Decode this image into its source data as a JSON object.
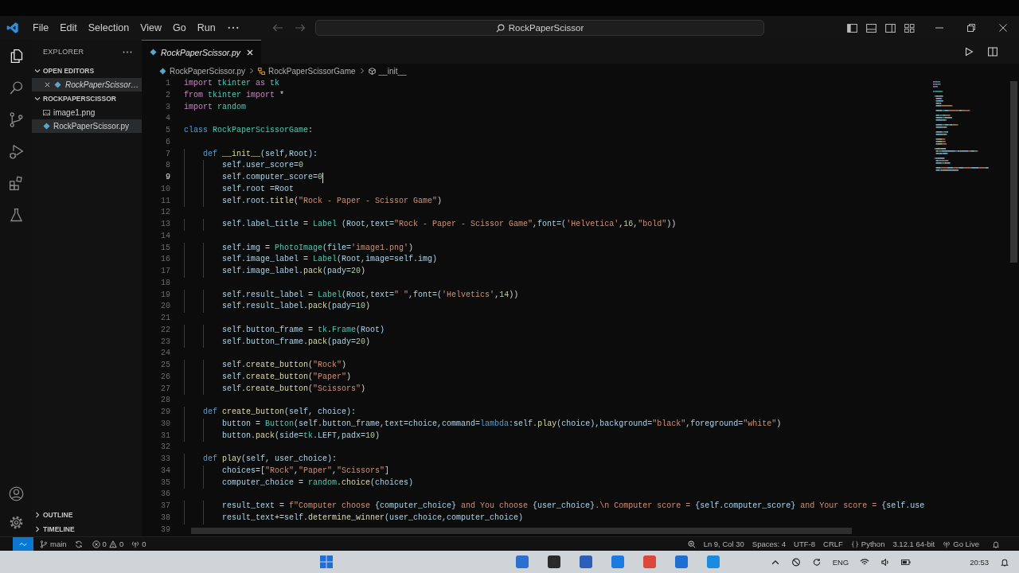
{
  "title_bar": {
    "menu": [
      "File",
      "Edit",
      "Selection",
      "View",
      "Go",
      "Run"
    ],
    "navigation": [
      {
        "kind": "back",
        "disabled": true
      },
      {
        "kind": "forward",
        "disabled": true
      }
    ],
    "command_center": "RockPaperScissor"
  },
  "activity_bar": [
    {
      "kind": "explorer",
      "selected": true
    },
    {
      "kind": "search",
      "selected": false
    },
    {
      "kind": "source_control",
      "selected": false
    },
    {
      "kind": "run_debug",
      "selected": false
    },
    {
      "kind": "extensions",
      "selected": false
    },
    {
      "kind": "testing",
      "selected": false
    }
  ],
  "sidebar": {
    "title": "EXPLORER",
    "sections": [
      {
        "label": "OPEN EDITORS",
        "kind": "open_editors",
        "expanded": true,
        "items": [
          {
            "name": "RockPaperScissor…",
            "kind": "python",
            "selected": true,
            "preview": true
          }
        ]
      },
      {
        "label": "ROCKPAPERSCISSOR",
        "kind": "folder",
        "expanded": true,
        "items": [
          {
            "name": "image1.png",
            "kind": "image",
            "selected": false,
            "preview": false
          },
          {
            "name": "RockPaperScissor.py",
            "kind": "python",
            "selected": true,
            "preview": false
          }
        ]
      }
    ],
    "bottom_sections": [
      {
        "label": "OUTLINE",
        "expanded": false
      },
      {
        "label": "TIMELINE",
        "expanded": false
      }
    ]
  },
  "editor": {
    "tabs": [
      {
        "label": "RockPaperScissor.py",
        "kind": "python",
        "selected": true,
        "preview": true
      }
    ],
    "breadcrumbs": [
      {
        "label": "RockPaperScissor.py",
        "kind": "file"
      },
      {
        "label": "RockPaperScissorGame",
        "kind": "class"
      },
      {
        "label": "__init__",
        "kind": "method"
      }
    ],
    "lines": [
      {
        "number": "1",
        "active": false,
        "tokens": [
          {
            "text": "import ",
            "kind": "kw"
          },
          {
            "text": "tkinter",
            "kind": "cls"
          },
          {
            "text": " as ",
            "kind": "kw"
          },
          {
            "text": "tk",
            "kind": "cls"
          }
        ]
      },
      {
        "number": "2",
        "active": false,
        "tokens": [
          {
            "text": "from ",
            "kind": "kw"
          },
          {
            "text": "tkinter",
            "kind": "cls"
          },
          {
            "text": " import ",
            "kind": "kw"
          },
          {
            "text": "*",
            "kind": "plain"
          }
        ]
      },
      {
        "number": "3",
        "active": false,
        "tokens": [
          {
            "text": "import ",
            "kind": "kw"
          },
          {
            "text": "random",
            "kind": "cls"
          }
        ]
      },
      {
        "number": "4",
        "active": false
      },
      {
        "number": "5",
        "active": false,
        "tokens": [
          {
            "text": "class ",
            "kind": "def"
          },
          {
            "text": "RockPaperScissorGame",
            "kind": "cls"
          },
          {
            "text": ":",
            "kind": "plain"
          }
        ]
      },
      {
        "number": "6",
        "active": false
      },
      {
        "number": "7",
        "active": false,
        "tokens": [
          {
            "text": "    def ",
            "kind": "def"
          },
          {
            "text": "__init__",
            "kind": "fn"
          },
          {
            "text": "(self,Root):",
            "kind": "var"
          }
        ]
      },
      {
        "number": "8",
        "active": false,
        "tokens": [
          {
            "text": "        self.user_score",
            "kind": "var"
          },
          {
            "text": "=",
            "kind": "plain"
          },
          {
            "text": "0",
            "kind": "num"
          }
        ]
      },
      {
        "number": "9",
        "active": true,
        "tokens": [
          {
            "text": "        self.computer_score",
            "kind": "var"
          },
          {
            "text": "=",
            "kind": "plain"
          },
          {
            "text": "0",
            "kind": "num"
          }
        ]
      },
      {
        "number": "10",
        "active": false,
        "tokens": [
          {
            "text": "        self.root ",
            "kind": "var"
          },
          {
            "text": "=",
            "kind": "plain"
          },
          {
            "text": "Root",
            "kind": "var"
          }
        ]
      },
      {
        "number": "11",
        "active": false,
        "tokens": [
          {
            "text": "        self.root.",
            "kind": "var"
          },
          {
            "text": "title",
            "kind": "fn"
          },
          {
            "text": "(",
            "kind": "plain"
          },
          {
            "text": "\"Rock - Paper - Scissor Game\"",
            "kind": "str"
          },
          {
            "text": ")",
            "kind": "plain"
          }
        ]
      },
      {
        "number": "12",
        "active": false
      },
      {
        "number": "13",
        "active": false,
        "tokens": [
          {
            "text": "        self.label_title ",
            "kind": "var"
          },
          {
            "text": "= ",
            "kind": "plain"
          },
          {
            "text": "Label",
            "kind": "cls"
          },
          {
            "text": " (Root,text=",
            "kind": "var"
          },
          {
            "text": "\"Rock - Paper - Scissor Game\"",
            "kind": "str"
          },
          {
            "text": ",font=(",
            "kind": "var"
          },
          {
            "text": "'Helvetica'",
            "kind": "str"
          },
          {
            "text": ",",
            "kind": "plain"
          },
          {
            "text": "16",
            "kind": "num"
          },
          {
            "text": ",",
            "kind": "plain"
          },
          {
            "text": "\"bold\"",
            "kind": "str"
          },
          {
            "text": "))",
            "kind": "plain"
          }
        ]
      },
      {
        "number": "14",
        "active": false
      },
      {
        "number": "15",
        "active": false,
        "tokens": [
          {
            "text": "        self.img ",
            "kind": "var"
          },
          {
            "text": "= ",
            "kind": "plain"
          },
          {
            "text": "PhotoImage",
            "kind": "cls"
          },
          {
            "text": "(file=",
            "kind": "var"
          },
          {
            "text": "'image1.png'",
            "kind": "str"
          },
          {
            "text": ")",
            "kind": "plain"
          }
        ]
      },
      {
        "number": "16",
        "active": false,
        "tokens": [
          {
            "text": "        self.image_label ",
            "kind": "var"
          },
          {
            "text": "= ",
            "kind": "plain"
          },
          {
            "text": "Label",
            "kind": "cls"
          },
          {
            "text": "(Root,image=self.img)",
            "kind": "var"
          }
        ]
      },
      {
        "number": "17",
        "active": false,
        "tokens": [
          {
            "text": "        self.image_label.",
            "kind": "var"
          },
          {
            "text": "pack",
            "kind": "fn"
          },
          {
            "text": "(pady=",
            "kind": "var"
          },
          {
            "text": "20",
            "kind": "num"
          },
          {
            "text": ")",
            "kind": "plain"
          }
        ]
      },
      {
        "number": "18",
        "active": false
      },
      {
        "number": "19",
        "active": false,
        "tokens": [
          {
            "text": "        self.result_label ",
            "kind": "var"
          },
          {
            "text": "= ",
            "kind": "plain"
          },
          {
            "text": "Label",
            "kind": "cls"
          },
          {
            "text": "(Root,text=",
            "kind": "var"
          },
          {
            "text": "\" \"",
            "kind": "str"
          },
          {
            "text": ",font=(",
            "kind": "var"
          },
          {
            "text": "'Helvetics'",
            "kind": "str"
          },
          {
            "text": ",",
            "kind": "plain"
          },
          {
            "text": "14",
            "kind": "num"
          },
          {
            "text": "))",
            "kind": "plain"
          }
        ]
      },
      {
        "number": "20",
        "active": false,
        "tokens": [
          {
            "text": "        self.result_label.",
            "kind": "var"
          },
          {
            "text": "pack",
            "kind": "fn"
          },
          {
            "text": "(pady=",
            "kind": "var"
          },
          {
            "text": "10",
            "kind": "num"
          },
          {
            "text": ")",
            "kind": "plain"
          }
        ]
      },
      {
        "number": "21",
        "active": false
      },
      {
        "number": "22",
        "active": false,
        "tokens": [
          {
            "text": "        self.button_frame ",
            "kind": "var"
          },
          {
            "text": "= ",
            "kind": "plain"
          },
          {
            "text": "tk",
            "kind": "cls"
          },
          {
            "text": ".",
            "kind": "plain"
          },
          {
            "text": "Frame",
            "kind": "cls"
          },
          {
            "text": "(Root)",
            "kind": "var"
          }
        ]
      },
      {
        "number": "23",
        "active": false,
        "tokens": [
          {
            "text": "        self.button_frame.",
            "kind": "var"
          },
          {
            "text": "pack",
            "kind": "fn"
          },
          {
            "text": "(pady=",
            "kind": "var"
          },
          {
            "text": "20",
            "kind": "num"
          },
          {
            "text": ")",
            "kind": "plain"
          }
        ]
      },
      {
        "number": "24",
        "active": false
      },
      {
        "number": "25",
        "active": false,
        "tokens": [
          {
            "text": "        self.",
            "kind": "var"
          },
          {
            "text": "create_button",
            "kind": "fn"
          },
          {
            "text": "(",
            "kind": "plain"
          },
          {
            "text": "\"Rock\"",
            "kind": "str"
          },
          {
            "text": ")",
            "kind": "plain"
          }
        ]
      },
      {
        "number": "26",
        "active": false,
        "tokens": [
          {
            "text": "        self.",
            "kind": "var"
          },
          {
            "text": "create_button",
            "kind": "fn"
          },
          {
            "text": "(",
            "kind": "plain"
          },
          {
            "text": "\"Paper\"",
            "kind": "str"
          },
          {
            "text": ")",
            "kind": "plain"
          }
        ]
      },
      {
        "number": "27",
        "active": false,
        "tokens": [
          {
            "text": "        self.",
            "kind": "var"
          },
          {
            "text": "create_button",
            "kind": "fn"
          },
          {
            "text": "(",
            "kind": "plain"
          },
          {
            "text": "\"Scissors\"",
            "kind": "str"
          },
          {
            "text": ")",
            "kind": "plain"
          }
        ]
      },
      {
        "number": "28",
        "active": false
      },
      {
        "number": "29",
        "active": false,
        "tokens": [
          {
            "text": "    def ",
            "kind": "def"
          },
          {
            "text": "create_button",
            "kind": "fn"
          },
          {
            "text": "(self, choice):",
            "kind": "var"
          }
        ]
      },
      {
        "number": "30",
        "active": false,
        "tokens": [
          {
            "text": "        button ",
            "kind": "var"
          },
          {
            "text": "= ",
            "kind": "plain"
          },
          {
            "text": "Button",
            "kind": "cls"
          },
          {
            "text": "(self.button_frame,text=choice,command=",
            "kind": "var"
          },
          {
            "text": "lambda",
            "kind": "def"
          },
          {
            "text": ":self.",
            "kind": "var"
          },
          {
            "text": "play",
            "kind": "fn"
          },
          {
            "text": "(choice),background=",
            "kind": "var"
          },
          {
            "text": "\"black\"",
            "kind": "str"
          },
          {
            "text": ",foreground=",
            "kind": "var"
          },
          {
            "text": "\"white\"",
            "kind": "str"
          },
          {
            "text": ")",
            "kind": "plain"
          }
        ]
      },
      {
        "number": "31",
        "active": false,
        "tokens": [
          {
            "text": "        button.",
            "kind": "var"
          },
          {
            "text": "pack",
            "kind": "fn"
          },
          {
            "text": "(side=",
            "kind": "var"
          },
          {
            "text": "tk",
            "kind": "cls"
          },
          {
            "text": ".LEFT,padx=",
            "kind": "var"
          },
          {
            "text": "10",
            "kind": "num"
          },
          {
            "text": ")",
            "kind": "plain"
          }
        ]
      },
      {
        "number": "32",
        "active": false
      },
      {
        "number": "33",
        "active": false,
        "tokens": [
          {
            "text": "    def ",
            "kind": "def"
          },
          {
            "text": "play",
            "kind": "fn"
          },
          {
            "text": "(self, user_choice):",
            "kind": "var"
          }
        ]
      },
      {
        "number": "34",
        "active": false,
        "tokens": [
          {
            "text": "        choices",
            "kind": "var"
          },
          {
            "text": "=[",
            "kind": "plain"
          },
          {
            "text": "\"Rock\"",
            "kind": "str"
          },
          {
            "text": ",",
            "kind": "plain"
          },
          {
            "text": "\"Paper\"",
            "kind": "str"
          },
          {
            "text": ",",
            "kind": "plain"
          },
          {
            "text": "\"Scissors\"",
            "kind": "str"
          },
          {
            "text": "]",
            "kind": "plain"
          }
        ]
      },
      {
        "number": "35",
        "active": false,
        "tokens": [
          {
            "text": "        computer_choice ",
            "kind": "var"
          },
          {
            "text": "= ",
            "kind": "plain"
          },
          {
            "text": "random",
            "kind": "cls"
          },
          {
            "text": ".",
            "kind": "plain"
          },
          {
            "text": "choice",
            "kind": "fn"
          },
          {
            "text": "(choices)",
            "kind": "var"
          }
        ]
      },
      {
        "number": "36",
        "active": false
      },
      {
        "number": "37",
        "active": false,
        "tokens": [
          {
            "text": "        result_text ",
            "kind": "var"
          },
          {
            "text": "= ",
            "kind": "plain"
          },
          {
            "text": "f\"Computer choose ",
            "kind": "str"
          },
          {
            "text": "{computer_choice}",
            "kind": "var"
          },
          {
            "text": " and You choose ",
            "kind": "str"
          },
          {
            "text": "{user_choice}",
            "kind": "var"
          },
          {
            "text": ".\\n Computer score = ",
            "kind": "str"
          },
          {
            "text": "{self.computer_score}",
            "kind": "var"
          },
          {
            "text": " and Your score = ",
            "kind": "str"
          },
          {
            "text": "{self.use",
            "kind": "var"
          }
        ]
      },
      {
        "number": "38",
        "active": false,
        "tokens": [
          {
            "text": "        result_text",
            "kind": "var"
          },
          {
            "text": "+=",
            "kind": "plain"
          },
          {
            "text": "self.",
            "kind": "var"
          },
          {
            "text": "determine_winner",
            "kind": "fn"
          },
          {
            "text": "(user_choice,computer_choice)",
            "kind": "var"
          }
        ]
      },
      {
        "number": "39",
        "active": false
      }
    ]
  },
  "status_bar": {
    "left": [
      {
        "kind": "remote"
      },
      {
        "kind": "branch",
        "text": "main"
      },
      {
        "kind": "sync"
      },
      {
        "kind": "problems",
        "errors": "0",
        "warnings": "0"
      },
      {
        "kind": "ports",
        "text": "0"
      }
    ],
    "right": [
      {
        "kind": "zoom"
      },
      {
        "kind": "text",
        "text": "Ln 9, Col 30"
      },
      {
        "kind": "text",
        "text": "Spaces: 4"
      },
      {
        "kind": "text",
        "text": "UTF-8"
      },
      {
        "kind": "text",
        "text": "CRLF"
      },
      {
        "kind": "language",
        "text": "Python"
      },
      {
        "kind": "text",
        "text": "3.12.1 64-bit"
      },
      {
        "kind": "golive",
        "text": "Go Live"
      },
      {
        "kind": "bell"
      }
    ]
  },
  "taskbar": {
    "language": "ENG",
    "time": "20:53"
  }
}
